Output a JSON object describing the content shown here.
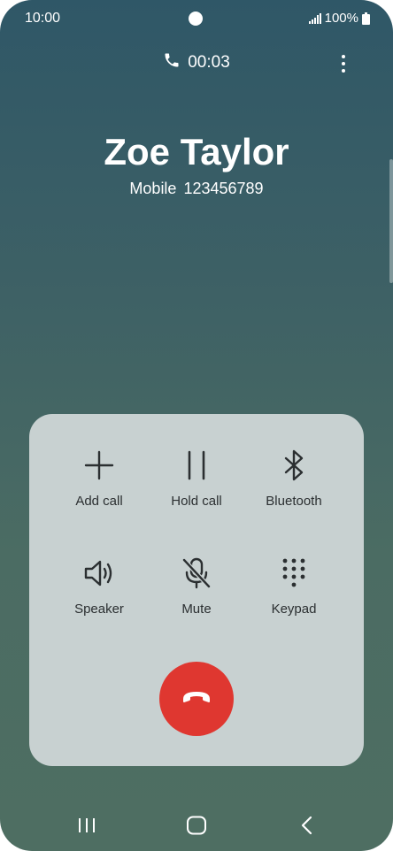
{
  "status_bar": {
    "time": "10:00",
    "battery": "100%"
  },
  "call": {
    "timer": "00:03",
    "contact_name": "Zoe Taylor",
    "number_type": "Mobile",
    "number": "123456789"
  },
  "controls": {
    "add_call": "Add call",
    "hold_call": "Hold call",
    "bluetooth": "Bluetooth",
    "speaker": "Speaker",
    "mute": "Mute",
    "keypad": "Keypad"
  },
  "colors": {
    "end_call": "#df3730",
    "panel": "#c8d1d1",
    "background_top": "#2f5767",
    "background_bottom": "#4e6e62"
  },
  "icons": [
    "phone-icon",
    "more-options-icon",
    "plus-icon",
    "pause-icon",
    "bluetooth-icon",
    "speaker-icon",
    "mute-icon",
    "keypad-icon",
    "end-call-icon",
    "recents-icon",
    "home-icon",
    "back-icon"
  ]
}
